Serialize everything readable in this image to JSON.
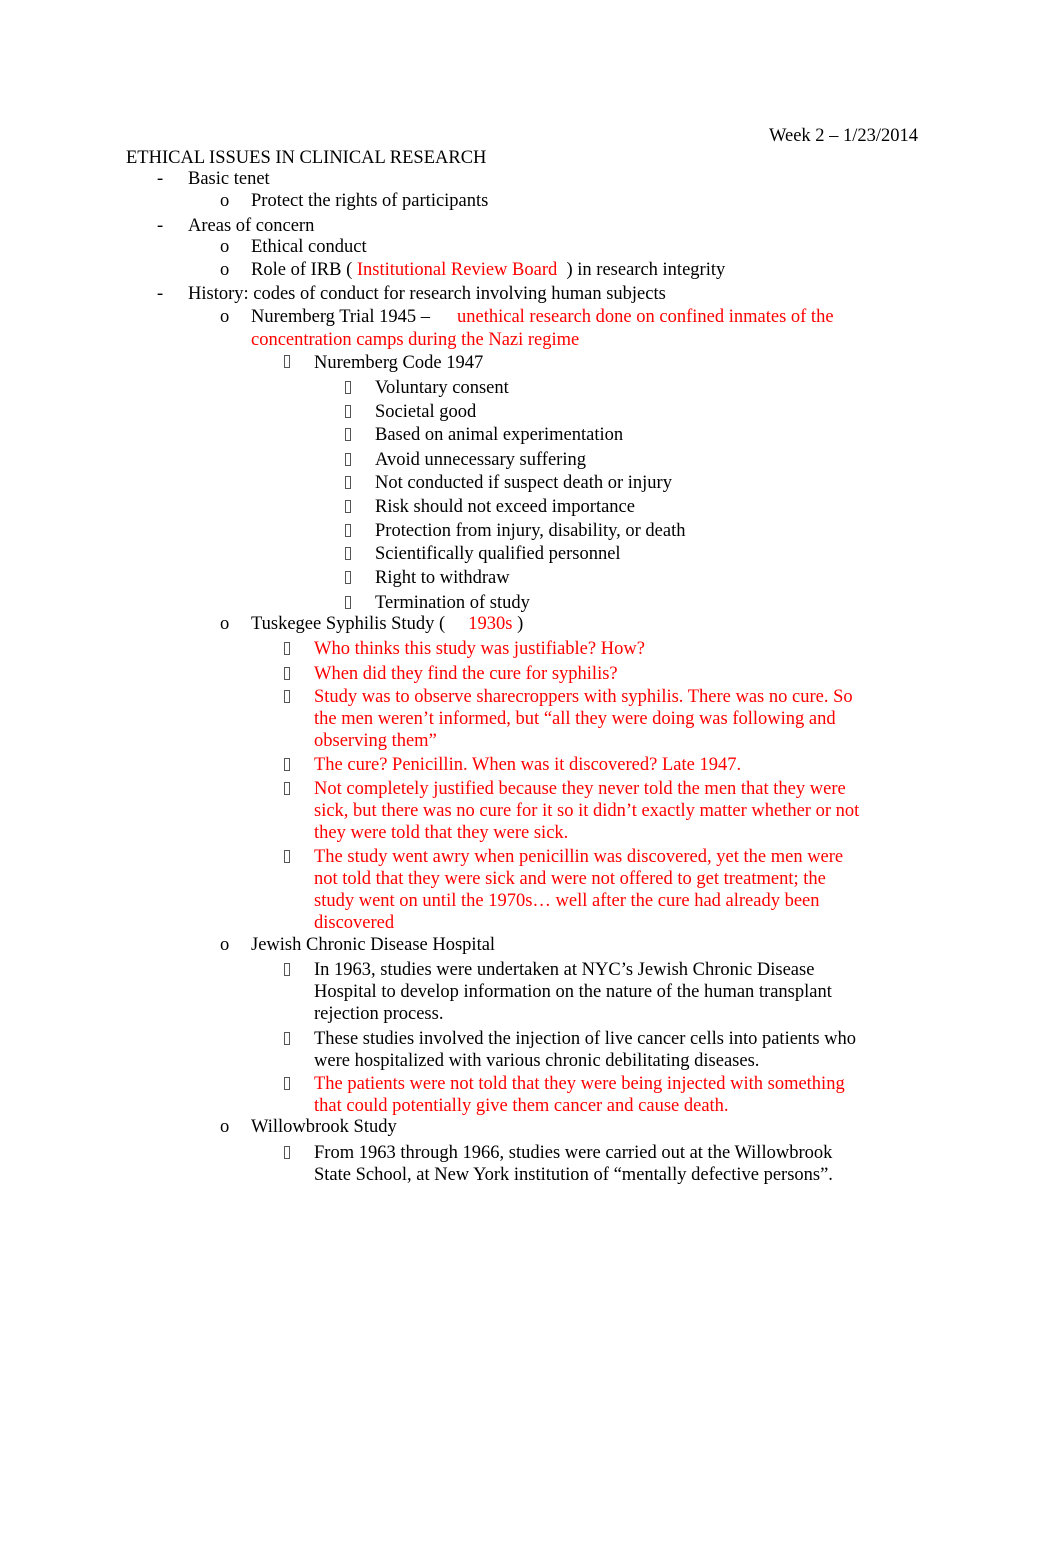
{
  "header": {
    "date": "Week 2 – 1/23/2014"
  },
  "title": "ETHICAL ISSUES IN CLINICAL RESEARCH",
  "bullets": {
    "dash": "-",
    "circle": "o"
  },
  "basic_tenet": {
    "label": "Basic tenet",
    "items": [
      "Protect the rights of participants"
    ]
  },
  "areas": {
    "label": "Areas of concern",
    "item1": "Ethical conduct",
    "item2_pre": "Role of IRB (",
    "item2_red": "Institutional Review Board",
    "item2_post": ") in research integrity"
  },
  "history": {
    "label": "History: codes of conduct for research involving human subjects",
    "nuremberg": {
      "label": "Nuremberg Trial 1945 –",
      "red_line1": "unethical research done on confined inmates of the",
      "red_line2": "concentration camps during the Nazi regime",
      "code_label": "Nuremberg Code 1947",
      "code_items": [
        "Voluntary consent",
        "Societal good",
        "Based on animal experimentation",
        "Avoid unnecessary suffering",
        "Not conducted if suspect death or injury",
        "Risk should not exceed importance",
        "Protection from injury, disability, or death",
        "Scientifically qualified personnel",
        "Right to withdraw",
        "Termination of study"
      ]
    },
    "tuskegee": {
      "label_pre": "Tuskegee Syphilis Study (",
      "label_red": "1930s",
      "label_post": ")",
      "items": [
        [
          "Who thinks this study was justifiable? How?"
        ],
        [
          "When did they find the cure for syphilis?"
        ],
        [
          "Study was to observe sharecroppers with syphilis. There was no cure. So",
          "the men weren’t informed, but “all they were doing was following and",
          "observing them”"
        ],
        [
          "The cure? Penicillin. When was it discovered? Late 1947."
        ],
        [
          "Not completely justified because they never told the men that they were",
          "sick, but there was no cure for it so it didn’t exactly matter whether or not",
          "they were told that they were sick."
        ],
        [
          "The study went awry when penicillin was discovered, yet the men were",
          "not told that they were sick and were not offered to get treatment; the",
          "study went on until the 1970s… well after the cure had already been",
          "discovered"
        ]
      ]
    },
    "jewish": {
      "label": "Jewish Chronic Disease Hospital",
      "items": [
        [
          "In 1963, studies were undertaken at NYC’s Jewish Chronic Disease",
          "Hospital to develop information on the nature of the human transplant",
          "rejection process."
        ],
        [
          "These studies involved the injection of live cancer cells into patients who",
          "were hospitalized with various chronic debilitating diseases."
        ],
        [
          "The patients were not told that they were being injected with something",
          "that could potentially give them cancer and cause death."
        ]
      ]
    },
    "willowbrook": {
      "label": "Willowbrook Study",
      "items": [
        [
          "From 1963 through 1966, studies were carried out at the Willowbrook",
          "State School, at New York institution of “mentally defective persons”."
        ]
      ]
    }
  }
}
